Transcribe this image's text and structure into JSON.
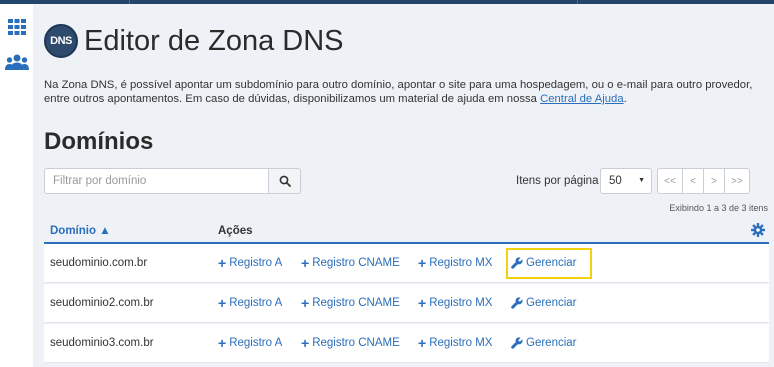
{
  "header": {
    "title": "Editor de Zona DNS",
    "logo_text": "DNS"
  },
  "sidebar": {
    "items": [
      {
        "icon": "apps-grid-icon"
      },
      {
        "icon": "users-icon"
      }
    ]
  },
  "intro": {
    "text": "Na Zona DNS, é possível apontar um subdomínio para outro domínio, apontar o site para uma hospedagem, ou o e-mail para outro provedor, entre outros apontamentos. Em caso de dúvidas, disponibilizamos um material de ajuda em nossa ",
    "link_text": "Central de Ajuda",
    "suffix": "."
  },
  "section_title": "Domínios",
  "filter": {
    "placeholder": "Filtrar por domínio",
    "value": ""
  },
  "pagination": {
    "per_page_label": "Itens por página",
    "per_page_value": "50",
    "first": "<<",
    "prev": "<",
    "next": ">",
    "last": ">>",
    "showing": "Exibindo 1 a 3 de 3 itens"
  },
  "table": {
    "col_domain": "Domínio ▲",
    "col_actions": "Ações",
    "actions": {
      "registro_a": "Registro A",
      "registro_cname": "Registro CNAME",
      "registro_mx": "Registro MX",
      "gerenciar": "Gerenciar"
    },
    "rows": [
      {
        "domain": "seudominio.com.br"
      },
      {
        "domain": "seudominio2.com.br"
      },
      {
        "domain": "seudominio3.com.br"
      }
    ]
  },
  "colors": {
    "accent": "#2a6ebb",
    "topbar": "#24456a",
    "highlight": "#f2d10f",
    "background": "#eef2f6"
  }
}
